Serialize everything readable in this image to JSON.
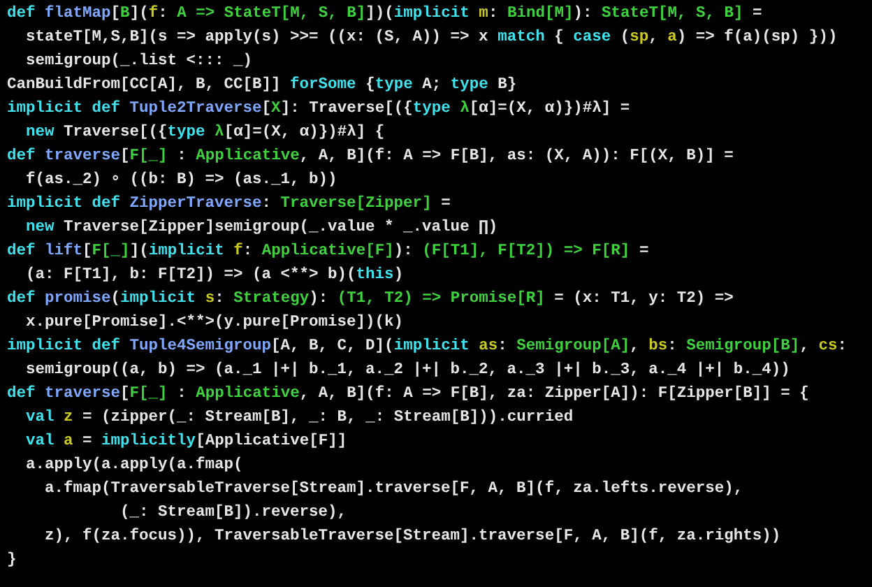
{
  "code_lines": [
    [
      {
        "kind": "keyword",
        "text": "def "
      },
      {
        "kind": "name",
        "text": "flatMap"
      },
      {
        "kind": "plain",
        "text": "["
      },
      {
        "kind": "type",
        "text": "B"
      },
      {
        "kind": "plain",
        "text": "]("
      },
      {
        "kind": "param",
        "text": "f"
      },
      {
        "kind": "plain",
        "text": ": "
      },
      {
        "kind": "type",
        "text": "A => StateT[M, S, B]"
      },
      {
        "kind": "plain",
        "text": "])("
      },
      {
        "kind": "keyword",
        "text": "implicit "
      },
      {
        "kind": "param",
        "text": "m"
      },
      {
        "kind": "plain",
        "text": ": "
      },
      {
        "kind": "type",
        "text": "Bind[M]"
      },
      {
        "kind": "plain",
        "text": "): "
      },
      {
        "kind": "type",
        "text": "StateT[M, S, B]"
      },
      {
        "kind": "plain",
        "text": " ="
      }
    ],
    [
      {
        "kind": "plain",
        "text": "  stateT[M,S,B](s => apply(s) >>= ((x: (S, A)) => x "
      },
      {
        "kind": "keyword",
        "text": "match"
      },
      {
        "kind": "plain",
        "text": " { "
      },
      {
        "kind": "keyword",
        "text": "case"
      },
      {
        "kind": "plain",
        "text": " ("
      },
      {
        "kind": "param",
        "text": "sp"
      },
      {
        "kind": "plain",
        "text": ", "
      },
      {
        "kind": "param",
        "text": "a"
      },
      {
        "kind": "plain",
        "text": ") => f(a)(sp) }))"
      }
    ],
    [
      {
        "kind": "plain",
        "text": "  semigroup(_.list <::: _)"
      }
    ],
    [
      {
        "kind": "plain",
        "text": "CanBuildFrom[CC[A], B, CC[B]] "
      },
      {
        "kind": "keyword",
        "text": "forSome"
      },
      {
        "kind": "plain",
        "text": " {"
      },
      {
        "kind": "keyword",
        "text": "type"
      },
      {
        "kind": "plain",
        "text": " A; "
      },
      {
        "kind": "keyword",
        "text": "type"
      },
      {
        "kind": "plain",
        "text": " B}"
      }
    ],
    [
      {
        "kind": "keyword",
        "text": "implicit def "
      },
      {
        "kind": "name",
        "text": "Tuple2Traverse"
      },
      {
        "kind": "plain",
        "text": "["
      },
      {
        "kind": "type",
        "text": "X"
      },
      {
        "kind": "plain",
        "text": "]: Traverse[({"
      },
      {
        "kind": "keyword",
        "text": "type "
      },
      {
        "kind": "type",
        "text": "λ"
      },
      {
        "kind": "plain",
        "text": "[α]=(X, α)})#λ] ="
      }
    ],
    [
      {
        "kind": "keyword",
        "text": "  new"
      },
      {
        "kind": "plain",
        "text": " Traverse[({"
      },
      {
        "kind": "keyword",
        "text": "type "
      },
      {
        "kind": "type",
        "text": "λ"
      },
      {
        "kind": "plain",
        "text": "[α]=(X, α)})#λ] {"
      }
    ],
    [
      {
        "kind": "keyword",
        "text": "def "
      },
      {
        "kind": "name",
        "text": "traverse"
      },
      {
        "kind": "plain",
        "text": "["
      },
      {
        "kind": "type",
        "text": "F[_]"
      },
      {
        "kind": "plain",
        "text": " : "
      },
      {
        "kind": "type",
        "text": "Applicative"
      },
      {
        "kind": "plain",
        "text": ", A, B](f: A => F[B], as: (X, A)): F[(X, B)] ="
      }
    ],
    [
      {
        "kind": "plain",
        "text": "  f(as._2) ∘ ((b: B) => (as._1, b))"
      }
    ],
    [
      {
        "kind": "keyword",
        "text": "implicit def "
      },
      {
        "kind": "name",
        "text": "ZipperTraverse"
      },
      {
        "kind": "plain",
        "text": ": "
      },
      {
        "kind": "type",
        "text": "Traverse[Zipper]"
      },
      {
        "kind": "plain",
        "text": " ="
      }
    ],
    [
      {
        "kind": "keyword",
        "text": "  new"
      },
      {
        "kind": "plain",
        "text": " Traverse[Zipper]semigroup(_.value * _.value ∏)"
      }
    ],
    [
      {
        "kind": "keyword",
        "text": "def "
      },
      {
        "kind": "name",
        "text": "lift"
      },
      {
        "kind": "plain",
        "text": "["
      },
      {
        "kind": "type",
        "text": "F[_]"
      },
      {
        "kind": "plain",
        "text": "]("
      },
      {
        "kind": "keyword",
        "text": "implicit "
      },
      {
        "kind": "param",
        "text": "f"
      },
      {
        "kind": "plain",
        "text": ": "
      },
      {
        "kind": "type",
        "text": "Applicative[F]"
      },
      {
        "kind": "plain",
        "text": "): "
      },
      {
        "kind": "type",
        "text": "(F[T1], F[T2]) => F[R]"
      },
      {
        "kind": "plain",
        "text": " ="
      }
    ],
    [
      {
        "kind": "plain",
        "text": "  (a: F[T1], b: F[T2]) => (a <**> b)("
      },
      {
        "kind": "keyword",
        "text": "this"
      },
      {
        "kind": "plain",
        "text": ")"
      }
    ],
    [
      {
        "kind": "keyword",
        "text": "def "
      },
      {
        "kind": "name",
        "text": "promise"
      },
      {
        "kind": "plain",
        "text": "("
      },
      {
        "kind": "keyword",
        "text": "implicit "
      },
      {
        "kind": "param",
        "text": "s"
      },
      {
        "kind": "plain",
        "text": ": "
      },
      {
        "kind": "type",
        "text": "Strategy"
      },
      {
        "kind": "plain",
        "text": "): "
      },
      {
        "kind": "type",
        "text": "(T1, T2) => Promise[R]"
      },
      {
        "kind": "plain",
        "text": " = (x: T1, y: T2) =>"
      }
    ],
    [
      {
        "kind": "plain",
        "text": "  x.pure[Promise].<**>(y.pure[Promise])(k)"
      }
    ],
    [
      {
        "kind": "keyword",
        "text": "implicit def "
      },
      {
        "kind": "name",
        "text": "Tuple4Semigroup"
      },
      {
        "kind": "plain",
        "text": "[A, B, C, D]("
      },
      {
        "kind": "keyword",
        "text": "implicit "
      },
      {
        "kind": "param",
        "text": "as"
      },
      {
        "kind": "plain",
        "text": ": "
      },
      {
        "kind": "type",
        "text": "Semigroup[A]"
      },
      {
        "kind": "plain",
        "text": ", "
      },
      {
        "kind": "param",
        "text": "bs"
      },
      {
        "kind": "plain",
        "text": ": "
      },
      {
        "kind": "type",
        "text": "Semigroup[B]"
      },
      {
        "kind": "plain",
        "text": ", "
      },
      {
        "kind": "param",
        "text": "cs"
      },
      {
        "kind": "plain",
        "text": ":"
      }
    ],
    [
      {
        "kind": "plain",
        "text": "  semigroup((a, b) => (a._1 |+| b._1, a._2 |+| b._2, a._3 |+| b._3, a._4 |+| b._4))"
      }
    ],
    [
      {
        "kind": "keyword",
        "text": "def "
      },
      {
        "kind": "name",
        "text": "traverse"
      },
      {
        "kind": "plain",
        "text": "["
      },
      {
        "kind": "type",
        "text": "F[_]"
      },
      {
        "kind": "plain",
        "text": " : "
      },
      {
        "kind": "type",
        "text": "Applicative"
      },
      {
        "kind": "plain",
        "text": ", A, B](f: A => F[B], za: Zipper[A]): F[Zipper[B]] = {"
      }
    ],
    [
      {
        "kind": "keyword",
        "text": "  val "
      },
      {
        "kind": "param",
        "text": "z"
      },
      {
        "kind": "plain",
        "text": " = (zipper(_: Stream[B], _: B, _: Stream[B])).curried"
      }
    ],
    [
      {
        "kind": "keyword",
        "text": "  val "
      },
      {
        "kind": "param",
        "text": "a"
      },
      {
        "kind": "plain",
        "text": " = "
      },
      {
        "kind": "keyword",
        "text": "implicitly"
      },
      {
        "kind": "plain",
        "text": "[Applicative[F]]"
      }
    ],
    [
      {
        "kind": "plain",
        "text": "  a.apply(a.apply(a.fmap("
      }
    ],
    [
      {
        "kind": "plain",
        "text": "    a.fmap(TraversableTraverse[Stream].traverse[F, A, B](f, za.lefts.reverse),"
      }
    ],
    [
      {
        "kind": "plain",
        "text": "            (_: Stream[B]).reverse),"
      }
    ],
    [
      {
        "kind": "plain",
        "text": "    z), f(za.focus)), TraversableTraverse[Stream].traverse[F, A, B](f, za.rights))"
      }
    ],
    [
      {
        "kind": "plain",
        "text": "}"
      }
    ]
  ]
}
